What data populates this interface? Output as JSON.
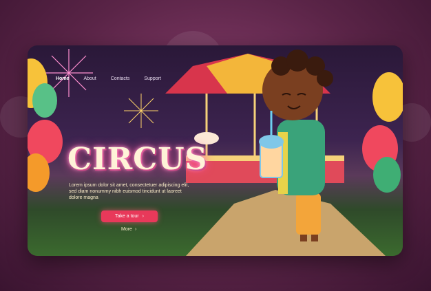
{
  "nav": {
    "items": [
      {
        "label": "Home",
        "active": true
      },
      {
        "label": "About",
        "active": false
      },
      {
        "label": "Contacts",
        "active": false
      },
      {
        "label": "Support",
        "active": false
      }
    ]
  },
  "hero": {
    "title": "CIRCUS",
    "text": "Lorem ipsum dolor sit amet, consectetuer adipiscing elit, sed diam nonummy nibh euismod tincidunt ut laoreet dolore magna",
    "tour_label": "Take a tour",
    "more_label": "More"
  },
  "colors": {
    "accent": "#e8395a",
    "title_glow": "#ff4fa0",
    "background": "#5a2447"
  },
  "icons": {
    "tour_arrow": "chevron-right-icon",
    "more_arrow": "chevron-right-icon"
  }
}
